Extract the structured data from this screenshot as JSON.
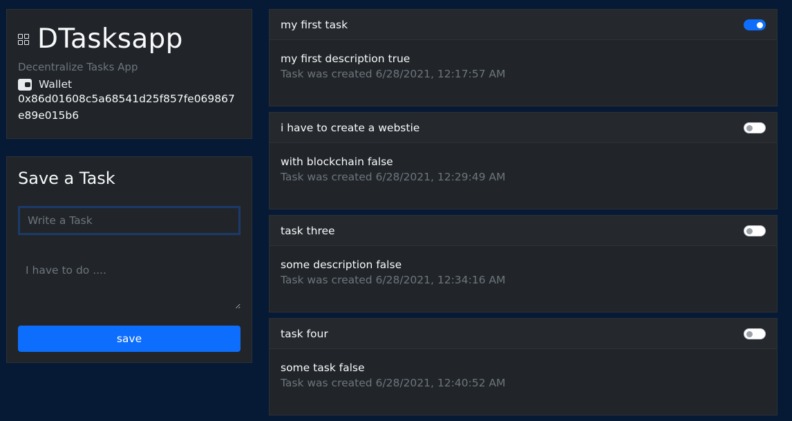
{
  "brand": {
    "title": "DTasksapp",
    "subtitle": "Decentralize Tasks App",
    "wallet_label": "Wallet",
    "wallet_address": "0x86d01608c5a68541d25f857fe069867e89e015b6",
    "title_icon": "grid-icon",
    "wallet_icon": "wallet-icon"
  },
  "form": {
    "title": "Save a Task",
    "task_placeholder": "Write a Task",
    "description_placeholder": "I have to do ....",
    "save_label": "save"
  },
  "tasks": [
    {
      "title": "my first task",
      "description": "my first description true",
      "created": "Task was created 6/28/2021, 12:17:57 AM",
      "done": true
    },
    {
      "title": "i have to create a webstie",
      "description": "with blockchain false",
      "created": "Task was created 6/28/2021, 12:29:49 AM",
      "done": false
    },
    {
      "title": "task three",
      "description": "some description false",
      "created": "Task was created 6/28/2021, 12:34:16 AM",
      "done": false
    },
    {
      "title": "task four",
      "description": "some task false",
      "created": "Task was created 6/28/2021, 12:40:52 AM",
      "done": false
    }
  ],
  "colors": {
    "background": "#071a35",
    "card": "#212529",
    "accent": "#0d6efd",
    "muted": "#6c757d"
  }
}
